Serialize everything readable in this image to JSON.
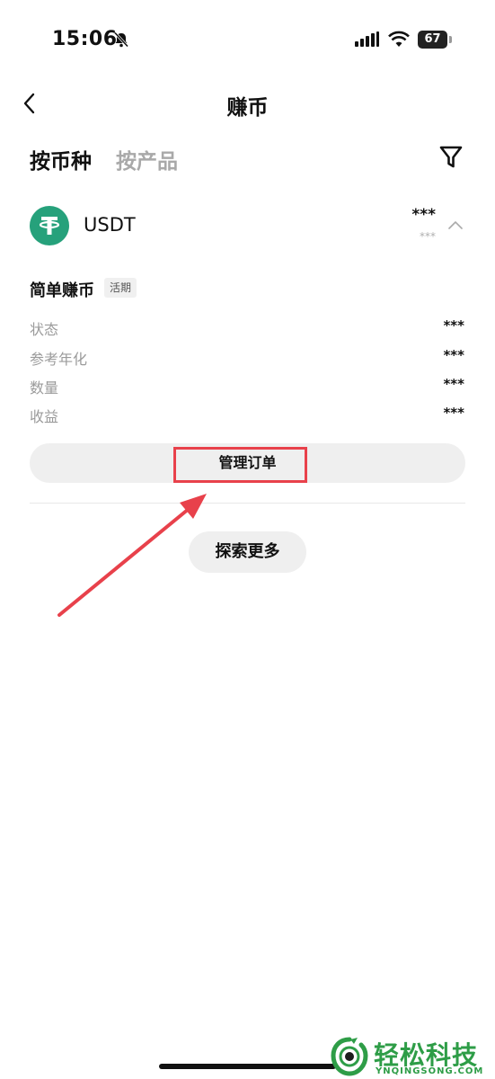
{
  "status_bar": {
    "time": "15:06",
    "battery": "67"
  },
  "nav": {
    "title": "赚币"
  },
  "tabs": [
    {
      "label": "按币种"
    },
    {
      "label": "按产品"
    }
  ],
  "asset": {
    "name": "USDT",
    "amount": "***",
    "sub_amount": "***"
  },
  "product": {
    "name": "简单赚币",
    "badge": "活期",
    "rows": [
      {
        "label": "状态",
        "value": "***"
      },
      {
        "label": "参考年化",
        "value": "***"
      },
      {
        "label": "数量",
        "value": "***"
      },
      {
        "label": "收益",
        "value": "***"
      }
    ],
    "manage_label": "管理订单"
  },
  "explore_label": "探索更多",
  "watermark": {
    "text": "轻松科技",
    "sub": "YNQINGSONG.COM"
  },
  "colors": {
    "accent_red": "#e8414b",
    "tether_green": "#26a17b",
    "watermark_green": "#2e9d47"
  }
}
